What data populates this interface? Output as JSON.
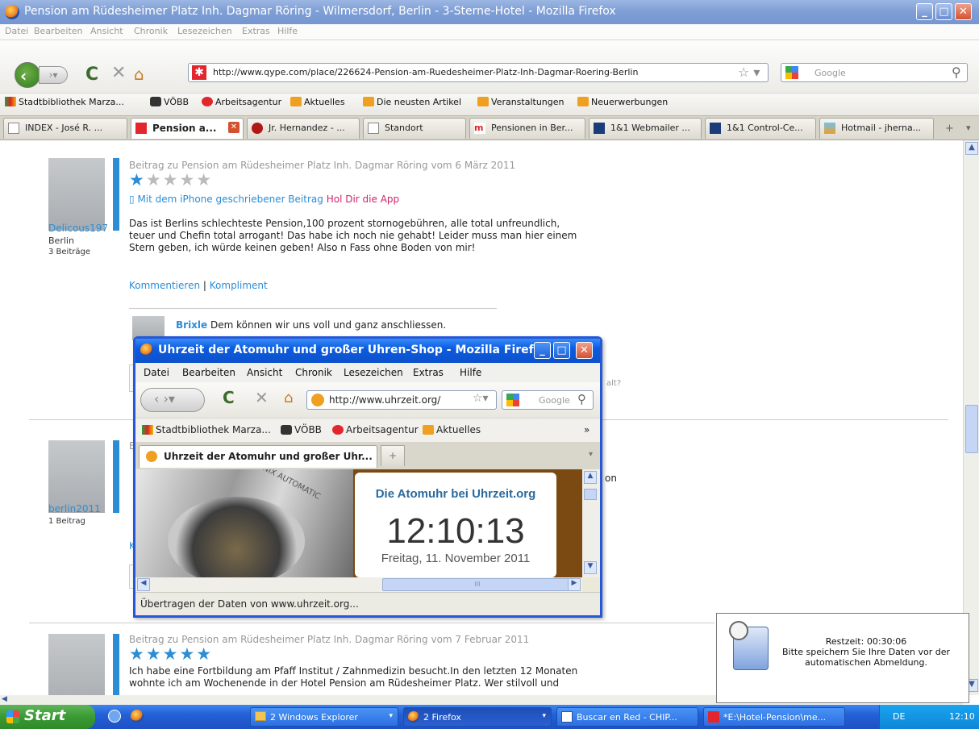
{
  "main_window": {
    "title": "Pension am Rüdesheimer Platz Inh. Dagmar Röring - Wilmersdorf, Berlin - 3-Sterne-Hotel - Mozilla Firefox",
    "menu": [
      "Datei",
      "Bearbeiten",
      "Ansicht",
      "Chronik",
      "Lesezeichen",
      "Extras",
      "Hilfe"
    ],
    "url": "http://www.qype.com/place/226624-Pension-am-Ruedesheimer-Platz-Inh-Dagmar-Roering-Berlin",
    "search_placeholder": "Google",
    "bookmarks": [
      "Stadtbibliothek Marza...",
      "VÖBB",
      "Arbeitsagentur",
      "Aktuelles",
      "Die neusten Artikel",
      "Veranstaltungen",
      "Neuerwerbungen"
    ],
    "tabs": [
      "INDEX - José R. ...",
      "Pension a...",
      "Jr. Hernandez - ...",
      "Standort",
      "Pensionen in Ber...",
      "1&1 Webmailer ...",
      "1&1 Control-Ce...",
      "Hotmail - jherna..."
    ],
    "new_tab_symbol": "+",
    "tab_menu_symbol": "▾"
  },
  "reviews": [
    {
      "user": "Delicous197",
      "city": "Berlin",
      "posts": "3 Beiträge",
      "meta": "Beitrag zu Pension am Rüdesheimer Platz Inh. Dagmar Röring vom 6 März 2011",
      "rating": 1,
      "iphone_note": "Mit dem iPhone geschriebener Beitrag",
      "app_link": "Hol Dir die App",
      "text_lines": [
        "Das ist Berlins schlechteste Pension,100 prozent stornogebühren, alle total unfreundlich,",
        "teuer und Chefin total arrogant! Das habe ich noch nie gehabt! Leider muss man hier einem",
        "Stern geben, ich würde keinen geben! Also n Fass ohne Boden von mir!"
      ],
      "action_comment": "Kommentieren",
      "action_separator": "|",
      "action_compliment": "Kompliment",
      "comment_user": "Brixle",
      "comment_text": "Dem können wir uns voll und ganz anschliessen.",
      "partial_right": "alt?"
    },
    {
      "user": "berlin2011",
      "posts": "1 Beitrag",
      "partial_meta_letter": "E",
      "partial_right": "on",
      "partial_link": "K"
    },
    {
      "meta": "Beitrag zu Pension am Rüdesheimer Platz Inh. Dagmar Röring vom 7 Februar 2011",
      "rating": 5,
      "text_lines": [
        "Ich habe eine Fortbildung am Pfaff Institut / Zahnmedizin besucht.In den letzten 12 Monaten",
        "wohnte ich am Wochenende in der Hotel Pension am Rüdesheimer Platz. Wer stilvoll und"
      ]
    }
  ],
  "popup_window": {
    "title": "Uhrzeit der Atomuhr und großer Uhren-Shop - Mozilla Firefox",
    "menu": [
      "Datei",
      "Bearbeiten",
      "Ansicht",
      "Chronik",
      "Lesezeichen",
      "Extras",
      "Hilfe"
    ],
    "url": "http://www.uhrzeit.org/",
    "search_placeholder": "Google",
    "bookmarks": [
      "Stadtbibliothek Marza...",
      "VÖBB",
      "Arbeitsagentur",
      "Aktuelles"
    ],
    "bookmarks_more": "»",
    "tab": "Uhrzeit der Atomuhr und großer Uhr...",
    "new_tab_symbol": "+",
    "clock_heading": "Die Atomuhr bei Uhrzeit.org",
    "clock_time": "12:10:13",
    "clock_date": "Freitag, 11. November 2011",
    "watch_text": "TRONIX AUTOMATIC",
    "scroll_mark": "III",
    "status": "Übertragen der Daten von www.uhrzeit.org..."
  },
  "notification": {
    "line1": "Restzeit:  00:30:06",
    "line2": "Bitte speichern Sie Ihre Daten vor der",
    "line3": "automatischen Abmeldung."
  },
  "taskbar": {
    "start": "Start",
    "buttons": [
      "2 Windows Explorer",
      "2 Firefox",
      "Buscar en Red - CHIP...",
      "*E:\\Hotel-Pension\\me..."
    ],
    "lang": "DE",
    "clock": "12:10"
  }
}
